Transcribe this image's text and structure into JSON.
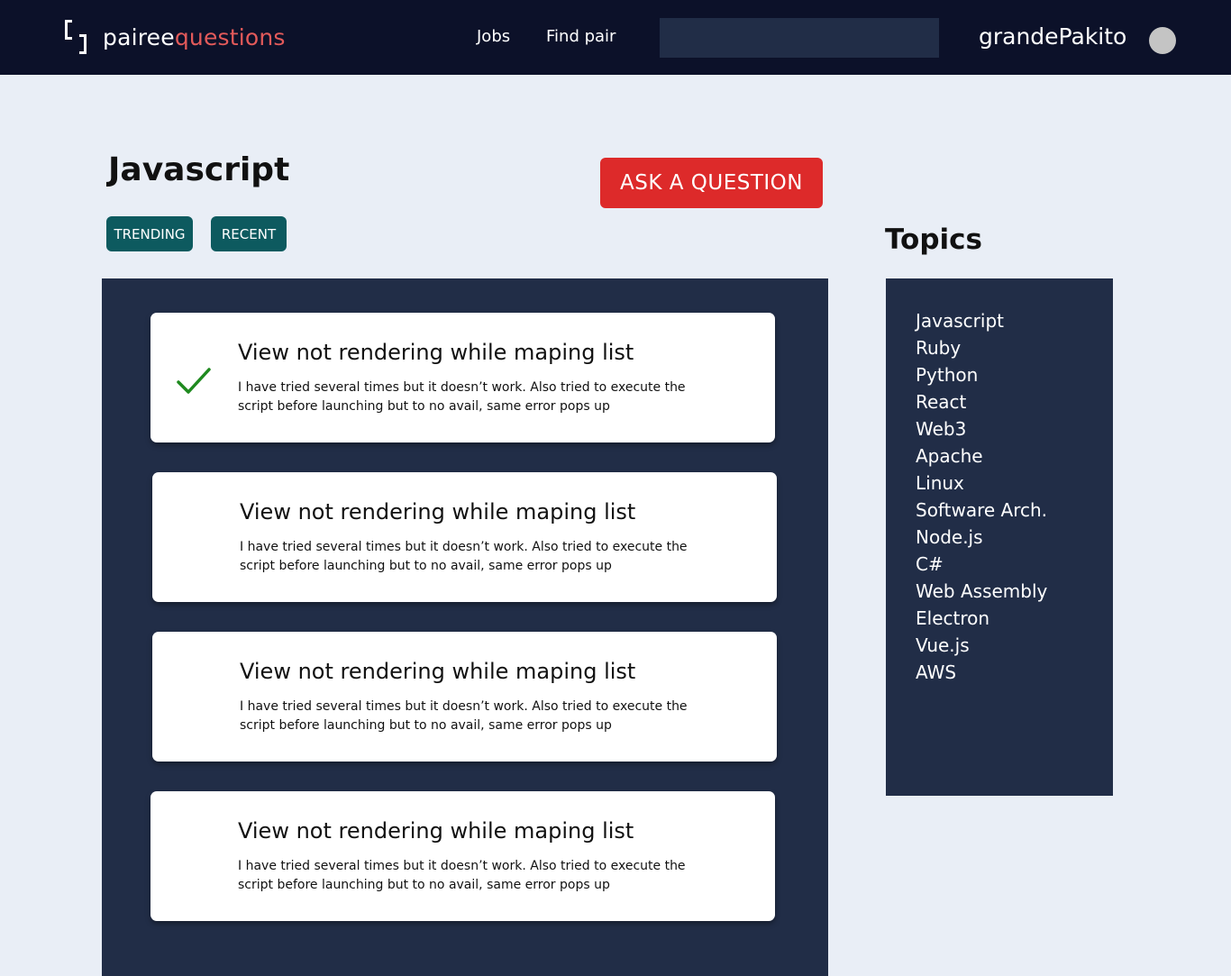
{
  "header": {
    "logo_primary": "pairee",
    "logo_accent": "questions",
    "nav": [
      "Jobs",
      "Find pair"
    ],
    "search_placeholder": "",
    "username": "grandePakito",
    "colors": {
      "background": "#0c1129",
      "logo_accent": "#e35a5a",
      "search_bg": "#212d47"
    }
  },
  "main": {
    "title": "Javascript",
    "ask_button": "ASK A QUESTION",
    "tabs": [
      "TRENDING",
      "RECENT"
    ],
    "colors": {
      "ask_button": "#dd2a2a",
      "tab": "#0d5a5f",
      "feed_bg": "#212d47"
    }
  },
  "questions": [
    {
      "title": "View not rendering while maping list",
      "body": "I have tried several times but it doesn’t work. Also tried to execute the script before launching but to no avail, same error pops up",
      "answered": true,
      "status_icon": "checkmark-icon"
    },
    {
      "title": "View not rendering while maping list",
      "body": "I have tried several times but it doesn’t work. Also tried to execute the script before launching but to no avail, same error pops up",
      "answered": false
    },
    {
      "title": "View not rendering while maping list",
      "body": "I have tried several times but it doesn’t work. Also tried to execute the script before launching but to no avail, same error pops up",
      "answered": false
    },
    {
      "title": "View not rendering while maping list",
      "body": "I have tried several times but it doesn’t work. Also tried to execute the script before launching but to no avail, same error pops up",
      "answered": false
    }
  ],
  "sidebar": {
    "heading": "Topics",
    "topics": [
      "Javascript",
      "Ruby",
      "Python",
      "React",
      "Web3",
      "Apache",
      "Linux",
      "Software Arch.",
      "Node.js",
      "C#",
      "Web Assembly",
      "Electron",
      "Vue.js",
      "AWS"
    ]
  }
}
